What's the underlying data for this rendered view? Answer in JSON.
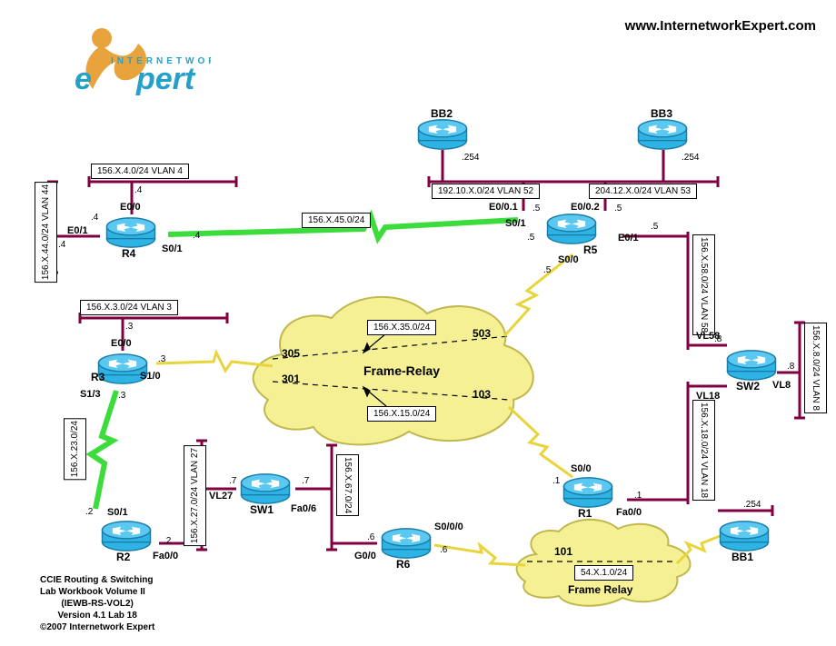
{
  "url": "www.InternetworkExpert.com",
  "logo": {
    "line1": "INTERNETWORK",
    "line2_part1": "e",
    "line2_part2": "pert"
  },
  "footer": {
    "l1": "CCIE Routing & Switching",
    "l2": "Lab Workbook Volume II",
    "l3": "(IEWB-RS-VOL2)",
    "l4": "Version 4.1 Lab 18",
    "l5": "©2007 Internetwork Expert"
  },
  "clouds": {
    "main": {
      "label": "Frame-Relay"
    },
    "r6": {
      "label": "Frame Relay",
      "subnet": "54.X.1.0/24"
    }
  },
  "subnets": {
    "vlan4": "156.X.4.0/24 VLAN 4",
    "vlan44": "156.X.44.0/24 VLAN 44",
    "vlan3": "156.X.3.0/24 VLAN 3",
    "r4r5": "156.X.45.0/24",
    "r3r5": "156.X.35.0/24",
    "r1r3": "156.X.15.0/24",
    "r2r3": "156.X.23.0/24",
    "vlan27": "156.X.27.0/24 VLAN 27",
    "sw1r6": "156.X.67.0/24",
    "vlan52": "192.10.X.0/24 VLAN 52",
    "vlan53": "204.12.X.0/24 VLAN 53",
    "vlan58": "156.X.58.0/24 VLAN 58",
    "vlan18": "156.X.18.0/24 VLAN 18",
    "vlan8": "156.X.8.0/24 VLAN 8"
  },
  "devices": {
    "r1": {
      "name": "R1",
      "fa00": "Fa0/0",
      "s00": "S0/0"
    },
    "r2": {
      "name": "R2",
      "fa00": "Fa0/0",
      "s01": "S0/1"
    },
    "r3": {
      "name": "R3",
      "e00": "E0/0",
      "s10": "S1/0",
      "s13": "S1/3"
    },
    "r4": {
      "name": "R4",
      "e00": "E0/0",
      "e01": "E0/1",
      "s01": "S0/1"
    },
    "r5": {
      "name": "R5",
      "e001": "E0/0.1",
      "e002": "E0/0.2",
      "e01": "E0/1",
      "s00": "S0/0",
      "s01": "S0/1"
    },
    "r6": {
      "name": "R6",
      "g00": "G0/0",
      "s000": "S0/0/0"
    },
    "sw1": {
      "name": "SW1",
      "vl27": "VL27",
      "fa06": "Fa0/6"
    },
    "sw2": {
      "name": "SW2",
      "vl58": "VL58",
      "vl18": "VL18",
      "vl8": "VL8"
    },
    "bb1": {
      "name": "BB1"
    },
    "bb2": {
      "name": "BB2"
    },
    "bb3": {
      "name": "BB3"
    }
  },
  "addrs": {
    "r4_4a": ".4",
    "r4_4b": ".4",
    "r4_4c": ".4",
    "r4_4d": ".4",
    "r3_3a": ".3",
    "r3_3b": ".3",
    "r3_3c": ".3",
    "r2_2a": ".2",
    "r2_2b": ".2",
    "r5_5a": ".5",
    "r5_5b": ".5",
    "r5_5c": ".5",
    "r5_5d": ".5",
    "r5_5e": ".5",
    "r1_1a": ".1",
    "r1_1b": ".1",
    "r6_6a": ".6",
    "r6_6b": ".6",
    "sw1_7a": ".7",
    "sw1_7b": ".7",
    "sw2_8a": ".8",
    "sw2_8b": ".8",
    "bb2_254": ".254",
    "bb3_254": ".254",
    "bb1_254": ".254"
  },
  "dlci": {
    "d305": "305",
    "d301": "301",
    "d503": "503",
    "d103": "103",
    "d101": "101"
  }
}
